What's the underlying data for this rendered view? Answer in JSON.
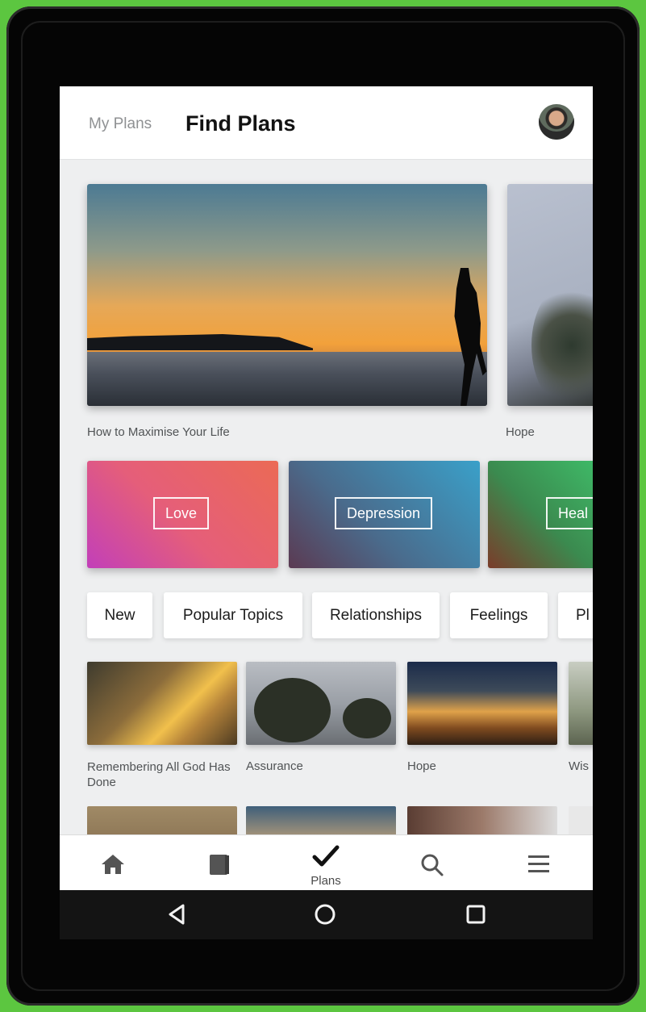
{
  "header": {
    "tab_my_plans": "My Plans",
    "tab_find_plans": "Find Plans"
  },
  "featured": [
    {
      "caption": "How to Maximise Your Life"
    },
    {
      "caption": "Hope"
    }
  ],
  "topics": [
    {
      "label": "Love"
    },
    {
      "label": "Depression"
    },
    {
      "label": "Heal"
    }
  ],
  "categories": [
    "New",
    "Popular Topics",
    "Relationships",
    "Feelings",
    "Pl"
  ],
  "plans": [
    {
      "caption": "Remembering All God Has Done"
    },
    {
      "caption": "Assurance"
    },
    {
      "caption": "Hope"
    },
    {
      "caption": "Wis"
    }
  ],
  "bottom_nav": {
    "items": [
      {
        "icon": "home-icon"
      },
      {
        "icon": "bible-icon"
      },
      {
        "icon": "check-icon",
        "label": "Plans",
        "active": true
      },
      {
        "icon": "search-icon"
      },
      {
        "icon": "menu-icon"
      }
    ]
  },
  "system_nav": [
    "back-icon",
    "home-circle-icon",
    "recents-icon"
  ],
  "colors": {
    "device_frame": "#050505",
    "background": "#5cc640",
    "screen_bg": "#eeeff0"
  }
}
